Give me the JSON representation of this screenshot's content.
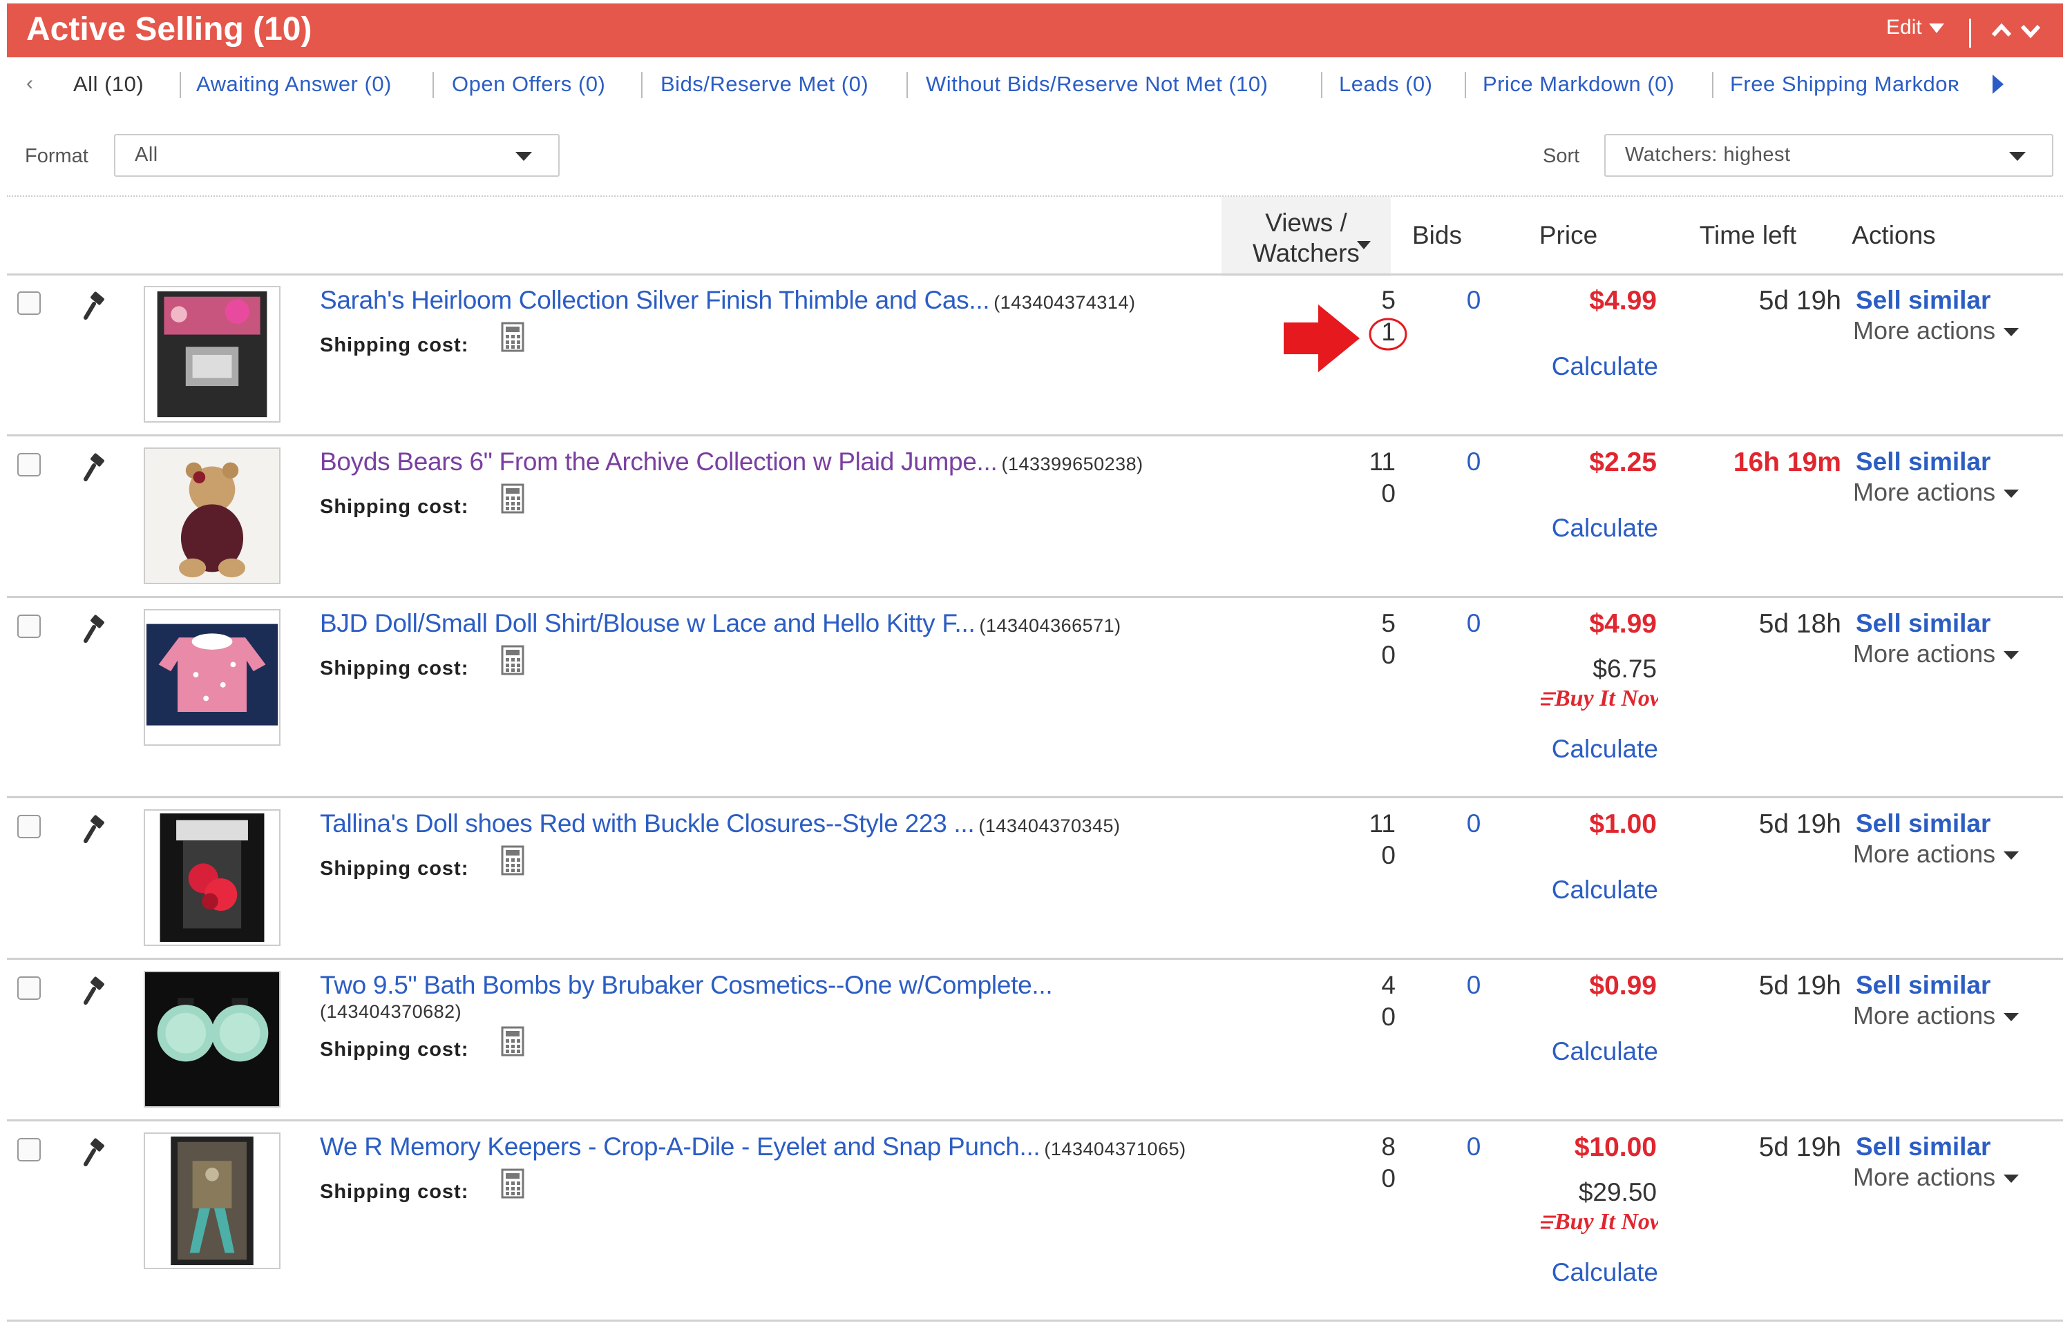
{
  "header": {
    "title": "Active Selling (10)",
    "edit_label": "Edit",
    "accent_color": "#e4574a"
  },
  "filters": {
    "tabs": [
      {
        "label": "All (10)",
        "active": true
      },
      {
        "label": "Awaiting Answer (0)"
      },
      {
        "label": "Open Offers (0)"
      },
      {
        "label": "Bids/Reserve Met (0)"
      },
      {
        "label": "Without Bids/Reserve Not Met (10)"
      },
      {
        "label": "Leads (0)"
      },
      {
        "label": "Price Markdown (0)"
      },
      {
        "label": "Free Shipping Markdoʀ"
      }
    ]
  },
  "format": {
    "label": "Format",
    "value": "All"
  },
  "sort": {
    "label": "Sort",
    "value": "Watchers: highest"
  },
  "columns": {
    "views": "Views /",
    "watchers": "Watchers",
    "bids": "Bids",
    "price": "Price",
    "time_left": "Time left",
    "actions": "Actions"
  },
  "common": {
    "shipping_label": "Shipping cost:",
    "calculate": "Calculate",
    "sell_similar": "Sell similar",
    "more_actions": "More actions"
  },
  "items": [
    {
      "title": "Sarah's Heirloom Collection Silver Finish Thimble and Cas...",
      "id": "(143404374314)",
      "views": "5",
      "watchers": "1",
      "bids": "0",
      "price": "$4.99",
      "time_left": "5d 19h"
    },
    {
      "title": "Boyds Bears 6\" From the Archive Collection w Plaid Jumpe...",
      "id": "(143399650238)",
      "views": "11",
      "watchers": "0",
      "bids": "0",
      "price": "$2.25",
      "time_left": "16h 19m"
    },
    {
      "title": "BJD Doll/Small Doll Shirt/Blouse w Lace and Hello Kitty F...",
      "id": "(143404366571)",
      "views": "5",
      "watchers": "0",
      "bids": "0",
      "price": "$4.99",
      "buy_it_now_price": "$6.75",
      "buy_it_now_label": "Buy It Now",
      "time_left": "5d 18h"
    },
    {
      "title": "Tallina's Doll shoes Red with Buckle Closures--Style 223 ...",
      "id": "(143404370345)",
      "views": "11",
      "watchers": "0",
      "bids": "0",
      "price": "$1.00",
      "time_left": "5d 19h"
    },
    {
      "title": "Two 9.5\" Bath Bombs by Brubaker Cosmetics--One w/Complete...",
      "id": "(143404370682)",
      "views": "4",
      "watchers": "0",
      "bids": "0",
      "price": "$0.99",
      "time_left": "5d 19h"
    },
    {
      "title": "We R Memory Keepers - Crop-A-Dile - Eyelet and Snap Punch...",
      "id": "(143404371065)",
      "views": "8",
      "watchers": "0",
      "bids": "0",
      "price": "$10.00",
      "buy_it_now_price": "$29.50",
      "buy_it_now_label": "Buy It Now",
      "time_left": "5d 19h"
    }
  ]
}
